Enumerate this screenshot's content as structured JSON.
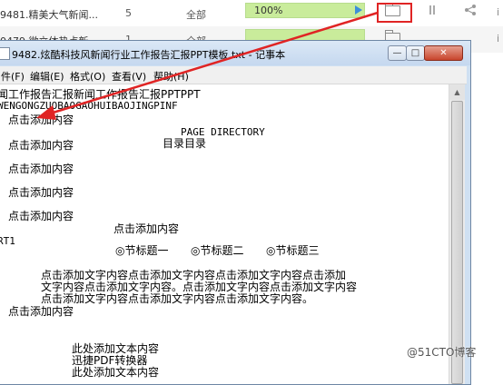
{
  "downloads": [
    {
      "name": "9481.精美大气新闻...",
      "count": "5",
      "scope": "全部",
      "progress_text": "100%",
      "progress": 1.0
    },
    {
      "name": "0479.微立体热点新...",
      "count": "1",
      "scope": "全部",
      "progress_text": "",
      "progress": 1.0
    }
  ],
  "notepad": {
    "title": "9482.炫酷科技风新闻行业工作报告汇报PPT模板.txt - 记事本",
    "controls": {
      "minimize": "—",
      "maximize": "□",
      "close": "✕"
    },
    "menus": [
      "件(F)",
      "编辑(E)",
      "格式(O)",
      "查看(V)",
      "帮助(H)"
    ],
    "content": {
      "line1": "闻工作报告汇报新闻工作报告汇报PPTPPT",
      "line2": "WENGONGZUOBAOGAOHUIBAOJINGPINF",
      "click1": "点击添加内容",
      "page_directory": "PAGE DIRECTORY",
      "click2": "点击添加内容",
      "directory": "目录目录",
      "click3": "点击添加内容",
      "click4": "点击添加内容",
      "click5": "点击添加内容",
      "click6": "点击添加内容",
      "rt1": "RT1",
      "section1": "◎节标题一",
      "section2": "◎节标题二",
      "section3": "◎节标题三",
      "para1": "点击添加文字内容点击添加文字内容点击添加文字内容点击添加",
      "para2": "文字内容点击添加文字内容。点击添加文字内容点击添加文字内容",
      "para3": "点击添加文字内容点击添加文字内容点击添加文字内容。",
      "click7": "点击添加内容",
      "here1": "此处添加文本内容",
      "xunjie": "迅捷PDF转换器",
      "here2": "此处添加文本内容"
    }
  },
  "watermark": "@51CTO博客",
  "colors": {
    "annotation_red": "#e02424",
    "progress_green": "#c9ec9b"
  }
}
